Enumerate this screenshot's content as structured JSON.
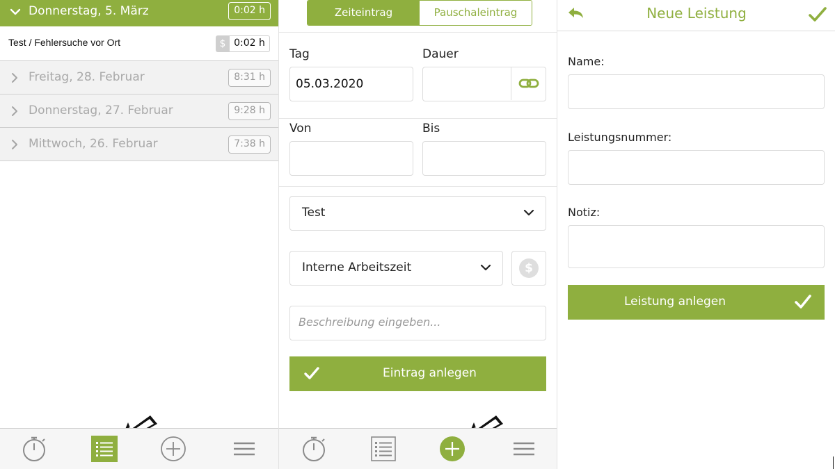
{
  "colors": {
    "accent": "#8faf3f",
    "muted_text": "#a9a9a9",
    "border": "#dcdcdc"
  },
  "list_screen": {
    "open_day": {
      "label": "Donnerstag, 5. März",
      "hours": "0:02 h"
    },
    "entry": {
      "label": "Test / Fehlersuche vor Ort",
      "billable_symbol": "$",
      "hours": "0:02 h"
    },
    "days": [
      {
        "label": "Freitag, 28. Februar",
        "hours": "8:31 h"
      },
      {
        "label": "Donnerstag, 27. Februar",
        "hours": "9:28 h"
      },
      {
        "label": "Mittwoch, 26. Februar",
        "hours": "7:38 h"
      }
    ],
    "tabbar": {
      "active_tab": "list",
      "icons": [
        "stopwatch-icon",
        "list-icon",
        "plus-circle-icon",
        "hamburger-menu-icon"
      ]
    }
  },
  "entry_screen": {
    "tabs": [
      "Zeiteintrag",
      "Pauschaleintrag"
    ],
    "active_tab": "Zeiteintrag",
    "day_label": "Tag",
    "day_value": "05.03.2020",
    "duration_label": "Dauer",
    "duration_value": "",
    "from_label": "Von",
    "from_value": "",
    "to_label": "Bis",
    "to_value": "",
    "project_value": "Test",
    "activity_value": "Interne Arbeitszeit",
    "billable_symbol": "$",
    "description_placeholder": "Beschreibung eingeben...",
    "submit_label": "Eintrag anlegen",
    "tabbar": {
      "active_tab": "add",
      "icons": [
        "stopwatch-icon",
        "list-icon",
        "plus-circle-icon",
        "hamburger-menu-icon"
      ]
    }
  },
  "service_screen": {
    "title": "Neue Leistung",
    "name_label": "Name:",
    "name_value": "",
    "number_label": "Leistungsnummer:",
    "number_value": "",
    "note_label": "Notiz:",
    "note_value": "",
    "submit_label": "Leistung anlegen"
  }
}
